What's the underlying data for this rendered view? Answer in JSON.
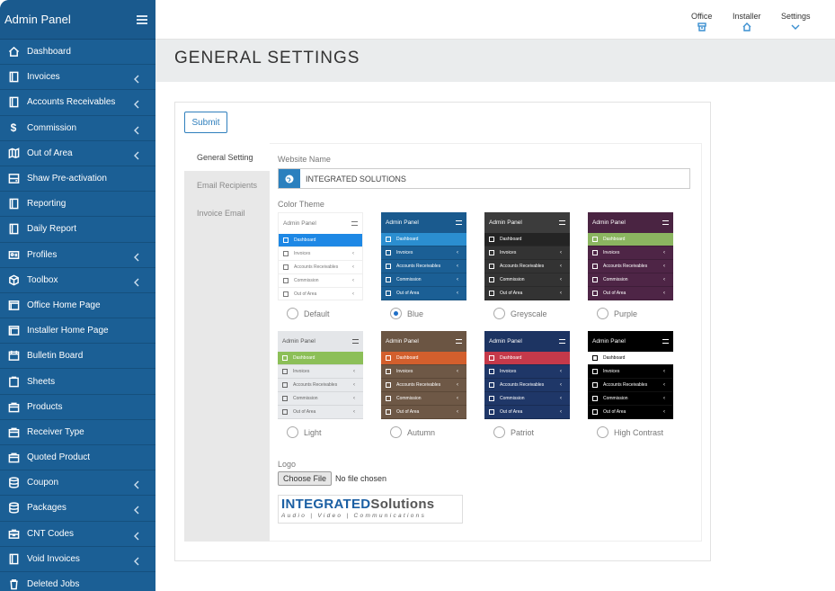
{
  "sidebar": {
    "title": "Admin Panel",
    "items": [
      {
        "label": "Dashboard",
        "icon": "home-icon",
        "chevron": false
      },
      {
        "label": "Invoices",
        "icon": "document-icon",
        "chevron": true
      },
      {
        "label": "Accounts Receivables",
        "icon": "document-icon",
        "chevron": true
      },
      {
        "label": "Commission",
        "icon": "dollar-icon",
        "chevron": true
      },
      {
        "label": "Out of Area",
        "icon": "map-icon",
        "chevron": true
      },
      {
        "label": "Shaw Pre-activation",
        "icon": "drive-icon",
        "chevron": false
      },
      {
        "label": "Reporting",
        "icon": "document-icon",
        "chevron": false
      },
      {
        "label": "Daily Report",
        "icon": "document-icon",
        "chevron": false
      },
      {
        "label": "Profiles",
        "icon": "id-card-icon",
        "chevron": true
      },
      {
        "label": "Toolbox",
        "icon": "cube-icon",
        "chevron": true
      },
      {
        "label": "Office Home Page",
        "icon": "window-icon",
        "chevron": false
      },
      {
        "label": "Installer Home Page",
        "icon": "window-icon",
        "chevron": false
      },
      {
        "label": "Bulletin Board",
        "icon": "calendar-icon",
        "chevron": false
      },
      {
        "label": "Sheets",
        "icon": "clipboard-icon",
        "chevron": false
      },
      {
        "label": "Products",
        "icon": "bag-icon",
        "chevron": false
      },
      {
        "label": "Receiver Type",
        "icon": "bag-icon",
        "chevron": false
      },
      {
        "label": "Quoted Product",
        "icon": "bag-icon",
        "chevron": false
      },
      {
        "label": "Coupon",
        "icon": "database-icon",
        "chevron": true
      },
      {
        "label": "Packages",
        "icon": "database-icon",
        "chevron": true
      },
      {
        "label": "CNT Codes",
        "icon": "briefcase-icon",
        "chevron": true
      },
      {
        "label": "Void Invoices",
        "icon": "document-icon",
        "chevron": true
      },
      {
        "label": "Deleted Jobs",
        "icon": "trash-icon",
        "chevron": false
      }
    ]
  },
  "topnav": [
    {
      "label": "Office",
      "icon": "archive-icon"
    },
    {
      "label": "Installer",
      "icon": "home-icon"
    },
    {
      "label": "Settings",
      "icon": "chevron-down-icon"
    }
  ],
  "page_title": "GENERAL SETTINGS",
  "submit_label": "Submit",
  "tabs": [
    {
      "label": "General Setting",
      "active": true
    },
    {
      "label": "Email Recipients",
      "active": false
    },
    {
      "label": "Invoice Email",
      "active": false
    }
  ],
  "website_name_label": "Website Name",
  "website_name_value": "INTEGRATED SOLUTIONS",
  "color_theme_label": "Color Theme",
  "theme_preview": {
    "title": "Admin Panel",
    "rows": [
      "Dashboard",
      "Invoices",
      "Accounts Receivables",
      "Commission",
      "Out of Area"
    ]
  },
  "themes": [
    {
      "name": "Default",
      "selected": false,
      "colors": {
        "head": "#ffffff",
        "headText": "#777777",
        "active": "#1e88e5",
        "body": "#ffffff",
        "text": "#777777",
        "border": "#eeeeee"
      }
    },
    {
      "name": "Blue",
      "selected": true,
      "colors": {
        "head": "#1a5a8e",
        "headText": "#ffffff",
        "active": "#2b8ed0",
        "body": "#1b5f95",
        "text": "#ffffff",
        "border": "#15507e"
      }
    },
    {
      "name": "Greyscale",
      "selected": false,
      "colors": {
        "head": "#3c3c3c",
        "headText": "#ffffff",
        "active": "#242424",
        "body": "#333333",
        "text": "#ffffff",
        "border": "#2a2a2a"
      }
    },
    {
      "name": "Purple",
      "selected": false,
      "colors": {
        "head": "#4a2442",
        "headText": "#ffffff",
        "active": "#8bb560",
        "body": "#4e2546",
        "text": "#ffffff",
        "border": "#3f1d39"
      }
    },
    {
      "name": "Light",
      "selected": false,
      "colors": {
        "head": "#e4e6e9",
        "headText": "#555555",
        "active": "#8cbf58",
        "body": "#e8eaed",
        "text": "#666666",
        "border": "#d6d8db"
      }
    },
    {
      "name": "Autumn",
      "selected": false,
      "colors": {
        "head": "#6b5543",
        "headText": "#ffffff",
        "active": "#d35f2d",
        "body": "#6e5846",
        "text": "#ffffff",
        "border": "#5c4838"
      }
    },
    {
      "name": "Patriot",
      "selected": false,
      "colors": {
        "head": "#1d3462",
        "headText": "#ffffff",
        "active": "#c5394a",
        "body": "#1f3768",
        "text": "#ffffff",
        "border": "#182c53"
      }
    },
    {
      "name": "High Contrast",
      "selected": false,
      "colors": {
        "head": "#000000",
        "headText": "#ffffff",
        "active": "#ffffff",
        "activeText": "#000000",
        "body": "#000000",
        "text": "#ffffff",
        "border": "#111111"
      }
    }
  ],
  "logo_label": "Logo",
  "file_button_label": "Choose File",
  "file_status": "No file chosen",
  "logo": {
    "main_a": "INTEGRATED",
    "main_b": "Solutions",
    "sub": "Audio | Video | Communications"
  }
}
